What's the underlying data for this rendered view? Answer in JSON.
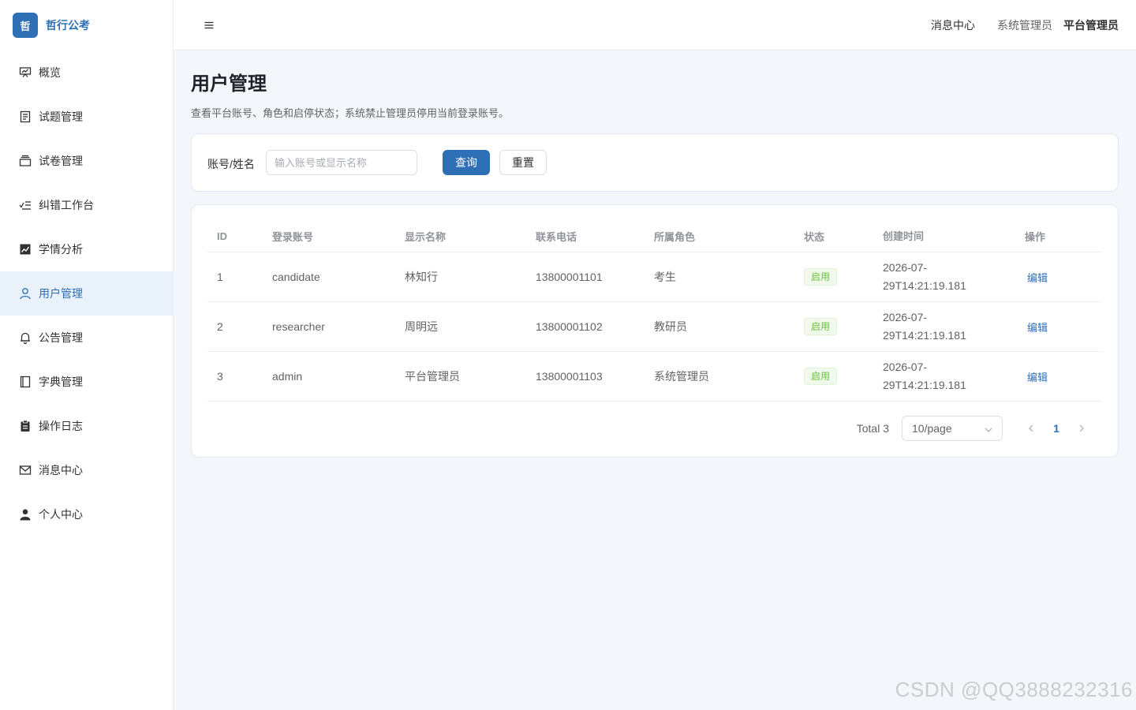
{
  "brand": {
    "logo_text": "哲",
    "name": "哲行公考"
  },
  "sidebar": {
    "items": [
      {
        "label": "概览",
        "icon": "presentation-icon",
        "active": false
      },
      {
        "label": "试题管理",
        "icon": "document-icon",
        "active": false
      },
      {
        "label": "试卷管理",
        "icon": "stack-icon",
        "active": false
      },
      {
        "label": "纠错工作台",
        "icon": "checklist-icon",
        "active": false
      },
      {
        "label": "学情分析",
        "icon": "trend-chart-icon",
        "active": false
      },
      {
        "label": "用户管理",
        "icon": "user-icon",
        "active": true
      },
      {
        "label": "公告管理",
        "icon": "bell-icon",
        "active": false
      },
      {
        "label": "字典管理",
        "icon": "book-icon",
        "active": false
      },
      {
        "label": "操作日志",
        "icon": "clipboard-icon",
        "active": false
      },
      {
        "label": "消息中心",
        "icon": "mail-icon",
        "active": false
      },
      {
        "label": "个人中心",
        "icon": "person-icon",
        "active": false
      }
    ]
  },
  "header": {
    "messages_label": "消息中心",
    "role_label": "系统管理员",
    "user_name": "平台管理员"
  },
  "page": {
    "title": "用户管理",
    "description": "查看平台账号、角色和启停状态；系统禁止管理员停用当前登录账号。"
  },
  "filter": {
    "label": "账号/姓名",
    "placeholder": "输入账号或显示名称",
    "value": "",
    "search_label": "查询",
    "reset_label": "重置"
  },
  "table": {
    "columns": [
      "ID",
      "登录账号",
      "显示名称",
      "联系电话",
      "所属角色",
      "状态",
      "创建时间",
      "操作"
    ],
    "rows": [
      {
        "id": "1",
        "account": "candidate",
        "name": "林知行",
        "phone": "13800001101",
        "role": "考生",
        "status": "启用",
        "time_line1": "2026-07-",
        "time_line2": "29T14:21:19.181",
        "action": "编辑"
      },
      {
        "id": "2",
        "account": "researcher",
        "name": "周明远",
        "phone": "13800001102",
        "role": "教研员",
        "status": "启用",
        "time_line1": "2026-07-",
        "time_line2": "29T14:21:19.181",
        "action": "编辑"
      },
      {
        "id": "3",
        "account": "admin",
        "name": "平台管理员",
        "phone": "13800001103",
        "role": "系统管理员",
        "status": "启用",
        "time_line1": "2026-07-",
        "time_line2": "29T14:21:19.181",
        "action": "编辑"
      }
    ]
  },
  "pagination": {
    "total_label": "Total 3",
    "page_size": "10/page",
    "current_page": "1"
  },
  "watermark": "CSDN @QQ3888232316",
  "colors": {
    "primary": "#2f6fb6",
    "success": "#67c23a",
    "background": "#f3f6fa"
  }
}
